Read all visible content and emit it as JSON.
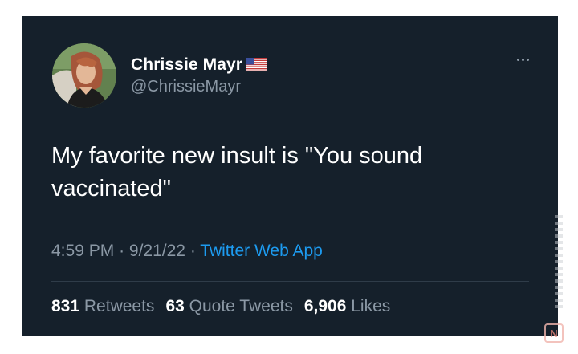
{
  "tweet": {
    "display_name": "Chrissie Mayr",
    "handle": "@ChrissieMayr",
    "text": "My favorite new insult is \"You sound vaccinated\"",
    "time": "4:59 PM",
    "separator": "·",
    "date": "9/21/22",
    "source": "Twitter Web App",
    "stats": [
      {
        "count": "831",
        "label": "Retweets"
      },
      {
        "count": "63",
        "label": "Quote Tweets"
      },
      {
        "count": "6,906",
        "label": "Likes"
      }
    ]
  },
  "icons": {
    "flag": "us-flag-icon",
    "more": "more-options-icon",
    "avatar": "avatar"
  },
  "colors": {
    "background": "#15202b",
    "text": "#ffffff",
    "secondary": "#8b98a5",
    "link": "#1d9bf0"
  }
}
